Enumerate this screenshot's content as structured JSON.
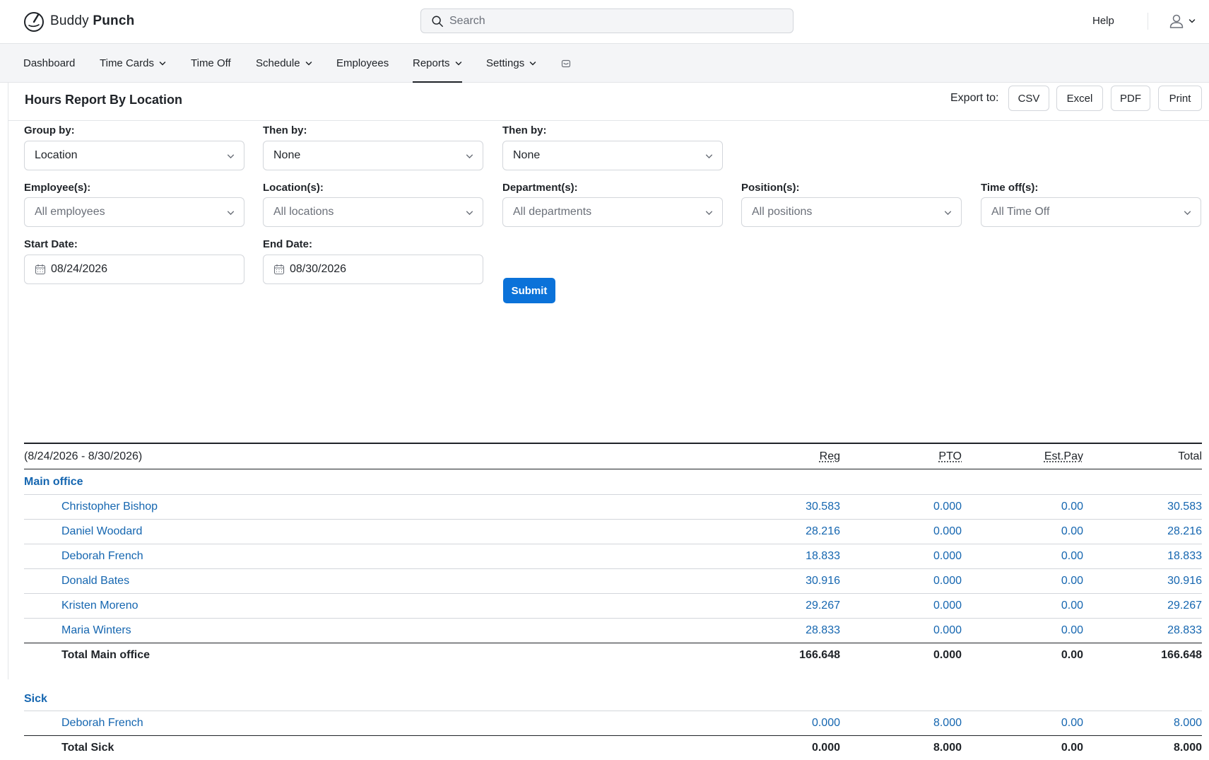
{
  "app": {
    "logo_text_regular": "Buddy",
    "logo_text_bold": "Punch"
  },
  "search": {
    "placeholder": "Search"
  },
  "header": {
    "help_label": "Help"
  },
  "nav": {
    "items": [
      {
        "label": "Dashboard",
        "has_dropdown": false
      },
      {
        "label": "Time Cards",
        "has_dropdown": true
      },
      {
        "label": "Time Off",
        "has_dropdown": false
      },
      {
        "label": "Schedule",
        "has_dropdown": true
      },
      {
        "label": "Employees",
        "has_dropdown": false
      },
      {
        "label": "Reports",
        "has_dropdown": true,
        "active": true
      },
      {
        "label": "Settings",
        "has_dropdown": true
      }
    ],
    "inbox_icon": "inbox-icon"
  },
  "page": {
    "title": "Hours Report By Location",
    "export_label": "Export to:",
    "export_buttons": [
      "CSV",
      "Excel",
      "PDF",
      "Print"
    ]
  },
  "filters": {
    "group_by_label": "Group by:",
    "group_by_value": "Location",
    "then_by_1_label": "Then by:",
    "then_by_1_value": "None",
    "then_by_2_label": "Then by:",
    "then_by_2_value": "None",
    "employees_label": "Employee(s):",
    "employees_placeholder": "All employees",
    "locations_label": "Location(s):",
    "locations_placeholder": "All locations",
    "departments_label": "Department(s):",
    "departments_placeholder": "All departments",
    "positions_label": "Position(s):",
    "positions_placeholder": "All positions",
    "timeoff_label": "Time off(s):",
    "timeoff_placeholder": "All Time Off",
    "start_date_label": "Start Date:",
    "start_date_value": "08/24/2026",
    "end_date_label": "End Date:",
    "end_date_value": "08/30/2026",
    "submit_label": "Submit"
  },
  "report": {
    "range": "(8/24/2026 - 8/30/2026)",
    "columns": [
      "Reg",
      "PTO",
      "Est.Pay",
      "Total"
    ],
    "groups": [
      {
        "name": "Main office",
        "rows": [
          {
            "name": "Christopher Bishop",
            "reg": "30.583",
            "pto": "0.000",
            "pay": "0.00",
            "total": "30.583"
          },
          {
            "name": "Daniel Woodard",
            "reg": "28.216",
            "pto": "0.000",
            "pay": "0.00",
            "total": "28.216"
          },
          {
            "name": "Deborah French",
            "reg": "18.833",
            "pto": "0.000",
            "pay": "0.00",
            "total": "18.833"
          },
          {
            "name": "Donald Bates",
            "reg": "30.916",
            "pto": "0.000",
            "pay": "0.00",
            "total": "30.916"
          },
          {
            "name": "Kristen Moreno",
            "reg": "29.267",
            "pto": "0.000",
            "pay": "0.00",
            "total": "29.267"
          },
          {
            "name": "Maria Winters",
            "reg": "28.833",
            "pto": "0.000",
            "pay": "0.00",
            "total": "28.833"
          }
        ],
        "total": {
          "label": "Total Main office",
          "reg": "166.648",
          "pto": "0.000",
          "pay": "0.00",
          "total": "166.648"
        }
      },
      {
        "name": "Sick",
        "rows": [
          {
            "name": "Deborah French",
            "reg": "0.000",
            "pto": "8.000",
            "pay": "0.00",
            "total": "8.000"
          }
        ],
        "total": {
          "label": "Total Sick",
          "reg": "0.000",
          "pto": "8.000",
          "pay": "0.00",
          "total": "8.000"
        }
      }
    ]
  }
}
